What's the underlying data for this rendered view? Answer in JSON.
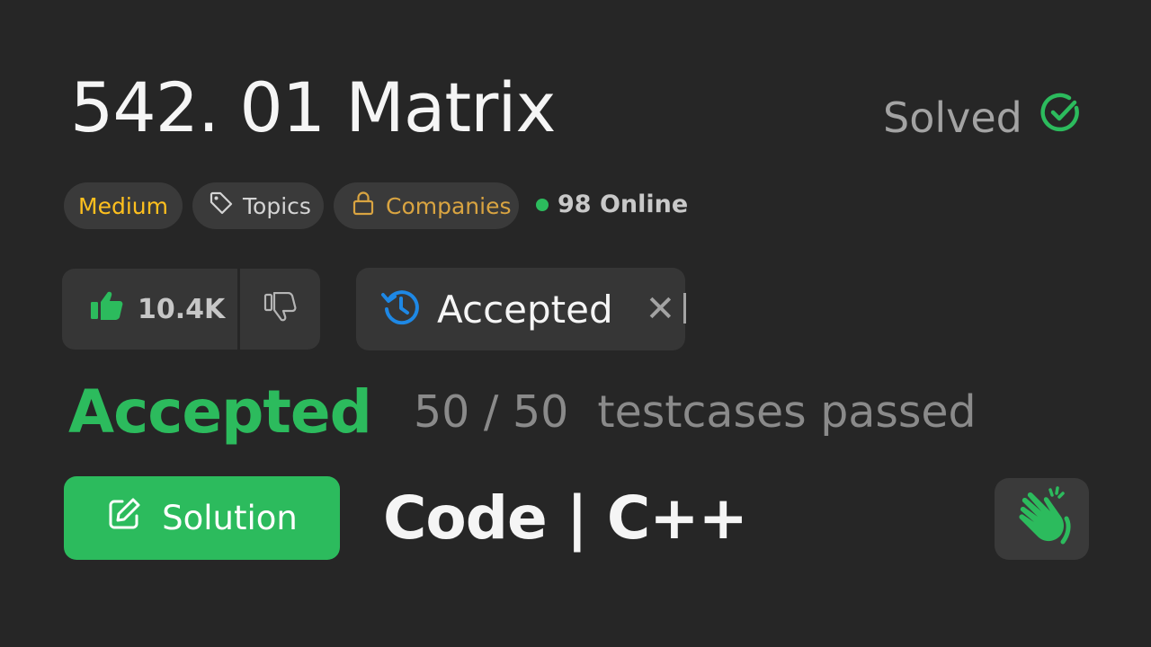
{
  "problem": {
    "title": "542. 01 Matrix",
    "status_label": "Solved",
    "difficulty": "Medium",
    "topics_label": "Topics",
    "companies_label": "Companies",
    "online_text": "98 Online"
  },
  "votes": {
    "likes": "10.4K"
  },
  "submission_tab": {
    "label": "Accepted",
    "close": "✕"
  },
  "result": {
    "status": "Accepted",
    "passed": "50 / 50",
    "passed_label": "testcases passed"
  },
  "actions": {
    "solution_label": "Solution",
    "code_title": "Code | C++"
  },
  "colors": {
    "accent_green": "#2cbb5d",
    "difficulty_medium": "#ffc01e",
    "companies": "#d9a441",
    "history_blue": "#1e88e5"
  },
  "icons": {
    "solved": "check-circle-icon",
    "topics": "tag-icon",
    "companies": "lock-icon",
    "like": "thumbs-up-icon",
    "dislike": "thumbs-down-icon",
    "history": "history-icon",
    "solution": "edit-icon",
    "wave": "waving-hand-icon"
  }
}
